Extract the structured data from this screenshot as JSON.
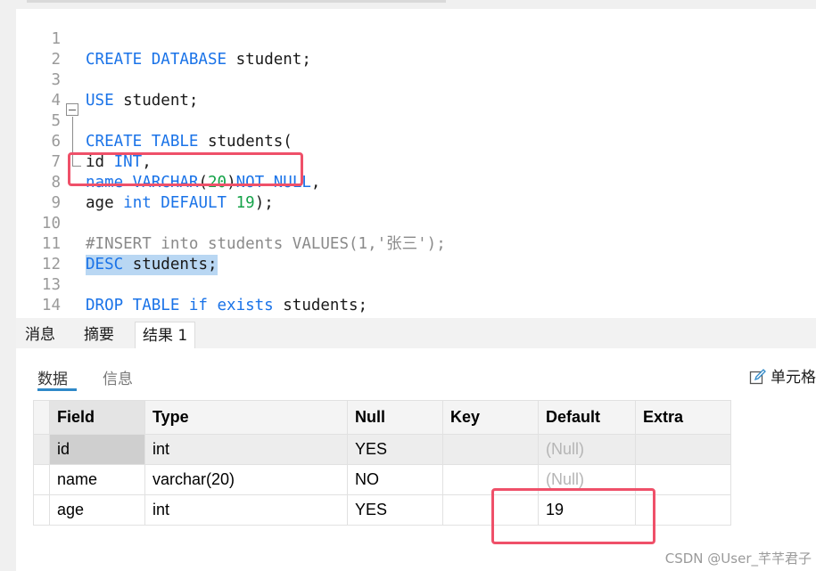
{
  "editor": {
    "lines": [
      {
        "n": "1"
      },
      {
        "n": "2"
      },
      {
        "n": "3"
      },
      {
        "n": "4"
      },
      {
        "n": "5"
      },
      {
        "n": "6"
      },
      {
        "n": "7"
      },
      {
        "n": "8"
      },
      {
        "n": "9"
      },
      {
        "n": "10"
      },
      {
        "n": "11"
      },
      {
        "n": "12"
      },
      {
        "n": "13"
      },
      {
        "n": "14"
      }
    ],
    "code": {
      "l1_kw": "CREATE DATABASE",
      "l1_rest": " student;",
      "l3_kw": "USE",
      "l3_rest": " student;",
      "l5_kw": "CREATE TABLE",
      "l5_rest": " students(",
      "l6_a": "id ",
      "l6_kw": "INT",
      "l6_b": ",",
      "l7_kw1": "name VARCHAR",
      "l7_p1": "(",
      "l7_num": "20",
      "l7_p2": ")",
      "l7_kw2": "NOT NULL",
      "l7_end": ",",
      "l8_a": "age ",
      "l8_kw": "int DEFAULT",
      "l8_sp": " ",
      "l8_num": "19",
      "l8_end": ");",
      "l10_comment": "#INSERT into students VALUES(1,'张三');",
      "l11_kw": "DESC",
      "l11_rest": " students;",
      "l13_kw": "DROP TABLE if exists",
      "l13_rest": " students;"
    }
  },
  "panel_tabs": [
    "消息",
    "摘要",
    "结果 1"
  ],
  "result": {
    "subtabs": [
      "数据",
      "信息"
    ],
    "cell_format_label": "单元格",
    "columns": [
      "Field",
      "Type",
      "Null",
      "Key",
      "Default",
      "Extra"
    ],
    "rows": [
      [
        "id",
        "int",
        "YES",
        "",
        "(Null)",
        ""
      ],
      [
        "name",
        "varchar(20)",
        "NO",
        "",
        "(Null)",
        ""
      ],
      [
        "age",
        "int",
        "YES",
        "",
        "19",
        ""
      ]
    ]
  },
  "watermark": "CSDN @User_芊芊君子",
  "colors": {
    "keyword": "#1a73e8",
    "number": "#16a34a",
    "highlight": "#ef5069"
  },
  "icons": [
    "pen-edit-icon",
    "fold-minus-icon"
  ]
}
